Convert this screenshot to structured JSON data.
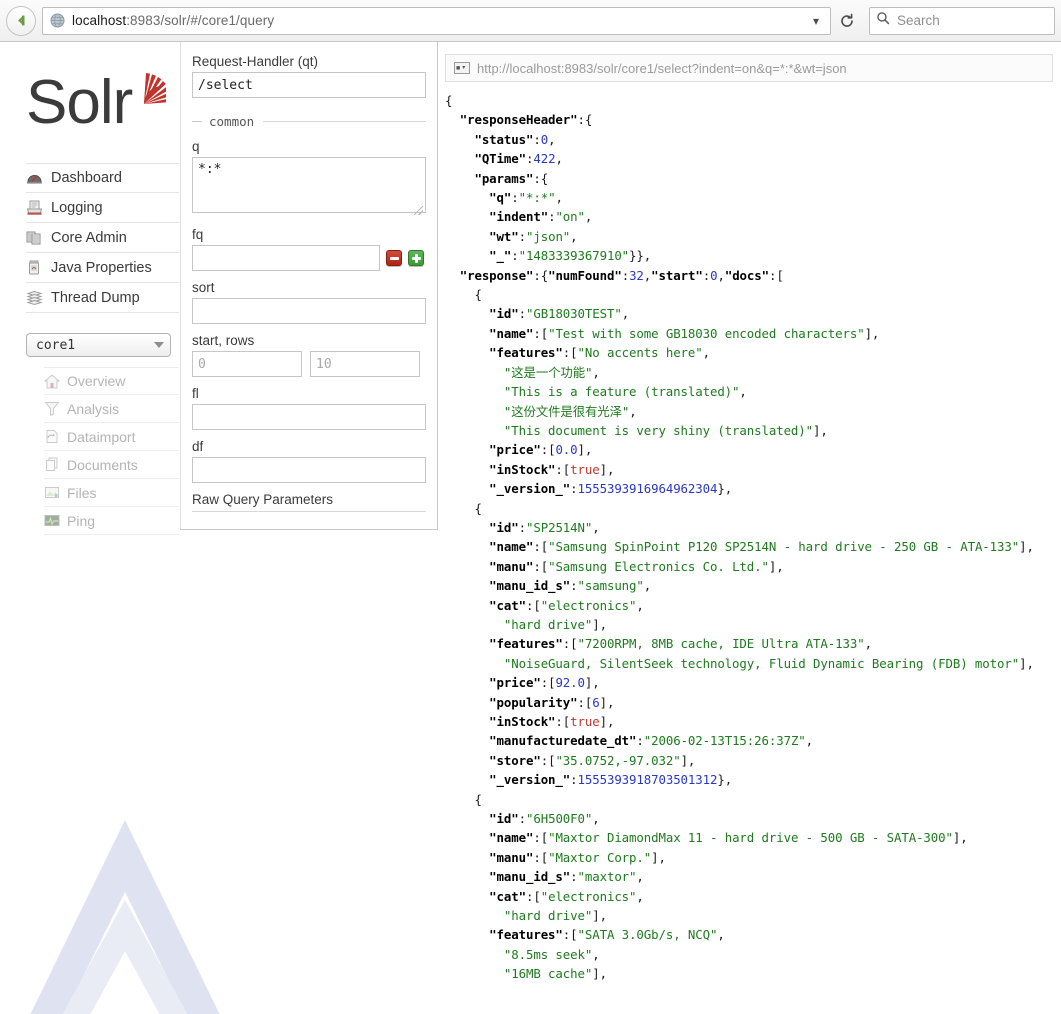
{
  "browser": {
    "url_host": "localhost",
    "url_rest": ":8983/solr/#/core1/query",
    "search_placeholder": "Search",
    "back_icon": "back-arrow-icon",
    "reload_icon": "reload-icon",
    "dropdown_icon": "chevron-down-icon",
    "search_icon": "search-icon",
    "globe_icon": "globe-icon"
  },
  "sidebar": {
    "logo_text": "Solr",
    "main_menu": [
      {
        "label": "Dashboard",
        "icon": "dashboard-icon"
      },
      {
        "label": "Logging",
        "icon": "logging-icon"
      },
      {
        "label": "Core Admin",
        "icon": "core-admin-icon"
      },
      {
        "label": "Java Properties",
        "icon": "java-properties-icon"
      },
      {
        "label": "Thread Dump",
        "icon": "thread-dump-icon"
      }
    ],
    "core_selector": {
      "value": "core1"
    },
    "core_menu": [
      {
        "label": "Overview",
        "icon": "overview-icon"
      },
      {
        "label": "Analysis",
        "icon": "analysis-icon"
      },
      {
        "label": "Dataimport",
        "icon": "dataimport-icon"
      },
      {
        "label": "Documents",
        "icon": "documents-icon"
      },
      {
        "label": "Files",
        "icon": "files-icon"
      },
      {
        "label": "Ping",
        "icon": "ping-icon"
      }
    ]
  },
  "query_form": {
    "request_handler_label": "Request-Handler (qt)",
    "request_handler_value": "/select",
    "section_common": "common",
    "q_label": "q",
    "q_value": "*:*",
    "fq_label": "fq",
    "fq_value": "",
    "fq_remove_label": "−",
    "fq_add_label": "+",
    "sort_label": "sort",
    "sort_value": "",
    "start_rows_label": "start, rows",
    "start_placeholder": "0",
    "start_value": "",
    "rows_placeholder": "10",
    "rows_value": "",
    "fl_label": "fl",
    "fl_value": "",
    "df_label": "df",
    "df_value": "",
    "raw_query_parameters_label": "Raw Query Parameters"
  },
  "response": {
    "request_url": "http://localhost:8983/solr/core1/select?indent=on&q=*:*&wt=json",
    "json_lines": [
      [
        [
          "p",
          "{"
        ]
      ],
      [
        [
          "p",
          "  "
        ],
        [
          "k",
          "\"responseHeader\""
        ],
        [
          "p",
          ":{"
        ]
      ],
      [
        [
          "p",
          "    "
        ],
        [
          "k",
          "\"status\""
        ],
        [
          "p",
          ":"
        ],
        [
          "n",
          "0"
        ],
        [
          "p",
          ","
        ]
      ],
      [
        [
          "p",
          "    "
        ],
        [
          "k",
          "\"QTime\""
        ],
        [
          "p",
          ":"
        ],
        [
          "n",
          "422"
        ],
        [
          "p",
          ","
        ]
      ],
      [
        [
          "p",
          "    "
        ],
        [
          "k",
          "\"params\""
        ],
        [
          "p",
          ":{"
        ]
      ],
      [
        [
          "p",
          "      "
        ],
        [
          "k",
          "\"q\""
        ],
        [
          "p",
          ":"
        ],
        [
          "s",
          "\"*:*\""
        ],
        [
          "p",
          ","
        ]
      ],
      [
        [
          "p",
          "      "
        ],
        [
          "k",
          "\"indent\""
        ],
        [
          "p",
          ":"
        ],
        [
          "s",
          "\"on\""
        ],
        [
          "p",
          ","
        ]
      ],
      [
        [
          "p",
          "      "
        ],
        [
          "k",
          "\"wt\""
        ],
        [
          "p",
          ":"
        ],
        [
          "s",
          "\"json\""
        ],
        [
          "p",
          ","
        ]
      ],
      [
        [
          "p",
          "      "
        ],
        [
          "k",
          "\"_\""
        ],
        [
          "p",
          ":"
        ],
        [
          "s",
          "\"1483339367910\""
        ],
        [
          "p",
          "}},"
        ]
      ],
      [
        [
          "p",
          "  "
        ],
        [
          "k",
          "\"response\""
        ],
        [
          "p",
          ":{"
        ],
        [
          "k",
          "\"numFound\""
        ],
        [
          "p",
          ":"
        ],
        [
          "n",
          "32"
        ],
        [
          "p",
          ","
        ],
        [
          "k",
          "\"start\""
        ],
        [
          "p",
          ":"
        ],
        [
          "n",
          "0"
        ],
        [
          "p",
          ","
        ],
        [
          "k",
          "\"docs\""
        ],
        [
          "p",
          ":["
        ]
      ],
      [
        [
          "p",
          "    {"
        ]
      ],
      [
        [
          "p",
          "      "
        ],
        [
          "k",
          "\"id\""
        ],
        [
          "p",
          ":"
        ],
        [
          "s",
          "\"GB18030TEST\""
        ],
        [
          "p",
          ","
        ]
      ],
      [
        [
          "p",
          "      "
        ],
        [
          "k",
          "\"name\""
        ],
        [
          "p",
          ":["
        ],
        [
          "s",
          "\"Test with some GB18030 encoded characters\""
        ],
        [
          "p",
          "],"
        ]
      ],
      [
        [
          "p",
          "      "
        ],
        [
          "k",
          "\"features\""
        ],
        [
          "p",
          ":["
        ],
        [
          "s",
          "\"No accents here\""
        ],
        [
          "p",
          ","
        ]
      ],
      [
        [
          "p",
          "        "
        ],
        [
          "s",
          "\"这是一个功能\""
        ],
        [
          "p",
          ","
        ]
      ],
      [
        [
          "p",
          "        "
        ],
        [
          "s",
          "\"This is a feature (translated)\""
        ],
        [
          "p",
          ","
        ]
      ],
      [
        [
          "p",
          "        "
        ],
        [
          "s",
          "\"这份文件是很有光泽\""
        ],
        [
          "p",
          ","
        ]
      ],
      [
        [
          "p",
          "        "
        ],
        [
          "s",
          "\"This document is very shiny (translated)\""
        ],
        [
          "p",
          "],"
        ]
      ],
      [
        [
          "p",
          "      "
        ],
        [
          "k",
          "\"price\""
        ],
        [
          "p",
          ":["
        ],
        [
          "n",
          "0.0"
        ],
        [
          "p",
          "],"
        ]
      ],
      [
        [
          "p",
          "      "
        ],
        [
          "k",
          "\"inStock\""
        ],
        [
          "p",
          ":["
        ],
        [
          "b",
          "true"
        ],
        [
          "p",
          "],"
        ]
      ],
      [
        [
          "p",
          "      "
        ],
        [
          "k",
          "\"_version_\""
        ],
        [
          "p",
          ":"
        ],
        [
          "n",
          "1555393916964962304"
        ],
        [
          "p",
          "},"
        ]
      ],
      [
        [
          "p",
          ""
        ]
      ],
      [
        [
          "p",
          "    {"
        ]
      ],
      [
        [
          "p",
          "      "
        ],
        [
          "k",
          "\"id\""
        ],
        [
          "p",
          ":"
        ],
        [
          "s",
          "\"SP2514N\""
        ],
        [
          "p",
          ","
        ]
      ],
      [
        [
          "p",
          "      "
        ],
        [
          "k",
          "\"name\""
        ],
        [
          "p",
          ":["
        ],
        [
          "s",
          "\"Samsung SpinPoint P120 SP2514N - hard drive - 250 GB - ATA-133\""
        ],
        [
          "p",
          "],"
        ]
      ],
      [
        [
          "p",
          "      "
        ],
        [
          "k",
          "\"manu\""
        ],
        [
          "p",
          ":["
        ],
        [
          "s",
          "\"Samsung Electronics Co. Ltd.\""
        ],
        [
          "p",
          "],"
        ]
      ],
      [
        [
          "p",
          "      "
        ],
        [
          "k",
          "\"manu_id_s\""
        ],
        [
          "p",
          ":"
        ],
        [
          "s",
          "\"samsung\""
        ],
        [
          "p",
          ","
        ]
      ],
      [
        [
          "p",
          "      "
        ],
        [
          "k",
          "\"cat\""
        ],
        [
          "p",
          ":["
        ],
        [
          "s",
          "\"electronics\""
        ],
        [
          "p",
          ","
        ]
      ],
      [
        [
          "p",
          "        "
        ],
        [
          "s",
          "\"hard drive\""
        ],
        [
          "p",
          "],"
        ]
      ],
      [
        [
          "p",
          "      "
        ],
        [
          "k",
          "\"features\""
        ],
        [
          "p",
          ":["
        ],
        [
          "s",
          "\"7200RPM, 8MB cache, IDE Ultra ATA-133\""
        ],
        [
          "p",
          ","
        ]
      ],
      [
        [
          "p",
          "        "
        ],
        [
          "s",
          "\"NoiseGuard, SilentSeek technology, Fluid Dynamic Bearing (FDB) motor\""
        ],
        [
          "p",
          "],"
        ]
      ],
      [
        [
          "p",
          "      "
        ],
        [
          "k",
          "\"price\""
        ],
        [
          "p",
          ":["
        ],
        [
          "n",
          "92.0"
        ],
        [
          "p",
          "],"
        ]
      ],
      [
        [
          "p",
          "      "
        ],
        [
          "k",
          "\"popularity\""
        ],
        [
          "p",
          ":["
        ],
        [
          "n",
          "6"
        ],
        [
          "p",
          "],"
        ]
      ],
      [
        [
          "p",
          "      "
        ],
        [
          "k",
          "\"inStock\""
        ],
        [
          "p",
          ":["
        ],
        [
          "b",
          "true"
        ],
        [
          "p",
          "],"
        ]
      ],
      [
        [
          "p",
          "      "
        ],
        [
          "k",
          "\"manufacturedate_dt\""
        ],
        [
          "p",
          ":"
        ],
        [
          "s",
          "\"2006-02-13T15:26:37Z\""
        ],
        [
          "p",
          ","
        ]
      ],
      [
        [
          "p",
          "      "
        ],
        [
          "k",
          "\"store\""
        ],
        [
          "p",
          ":["
        ],
        [
          "s",
          "\"35.0752,-97.032\""
        ],
        [
          "p",
          "],"
        ]
      ],
      [
        [
          "p",
          "      "
        ],
        [
          "k",
          "\"_version_\""
        ],
        [
          "p",
          ":"
        ],
        [
          "n",
          "1555393918703501312"
        ],
        [
          "p",
          "},"
        ]
      ],
      [
        [
          "p",
          "    {"
        ]
      ],
      [
        [
          "p",
          "      "
        ],
        [
          "k",
          "\"id\""
        ],
        [
          "p",
          ":"
        ],
        [
          "s",
          "\"6H500F0\""
        ],
        [
          "p",
          ","
        ]
      ],
      [
        [
          "p",
          "      "
        ],
        [
          "k",
          "\"name\""
        ],
        [
          "p",
          ":["
        ],
        [
          "s",
          "\"Maxtor DiamondMax 11 - hard drive - 500 GB - SATA-300\""
        ],
        [
          "p",
          "],"
        ]
      ],
      [
        [
          "p",
          "      "
        ],
        [
          "k",
          "\"manu\""
        ],
        [
          "p",
          ":["
        ],
        [
          "s",
          "\"Maxtor Corp.\""
        ],
        [
          "p",
          "],"
        ]
      ],
      [
        [
          "p",
          "      "
        ],
        [
          "k",
          "\"manu_id_s\""
        ],
        [
          "p",
          ":"
        ],
        [
          "s",
          "\"maxtor\""
        ],
        [
          "p",
          ","
        ]
      ],
      [
        [
          "p",
          "      "
        ],
        [
          "k",
          "\"cat\""
        ],
        [
          "p",
          ":["
        ],
        [
          "s",
          "\"electronics\""
        ],
        [
          "p",
          ","
        ]
      ],
      [
        [
          "p",
          "        "
        ],
        [
          "s",
          "\"hard drive\""
        ],
        [
          "p",
          "],"
        ]
      ],
      [
        [
          "p",
          "      "
        ],
        [
          "k",
          "\"features\""
        ],
        [
          "p",
          ":["
        ],
        [
          "s",
          "\"SATA 3.0Gb/s, NCQ\""
        ],
        [
          "p",
          ","
        ]
      ],
      [
        [
          "p",
          "        "
        ],
        [
          "s",
          "\"8.5ms seek\""
        ],
        [
          "p",
          ","
        ]
      ],
      [
        [
          "p",
          "        "
        ],
        [
          "s",
          "\"16MB cache\""
        ],
        [
          "p",
          "],"
        ]
      ]
    ]
  }
}
